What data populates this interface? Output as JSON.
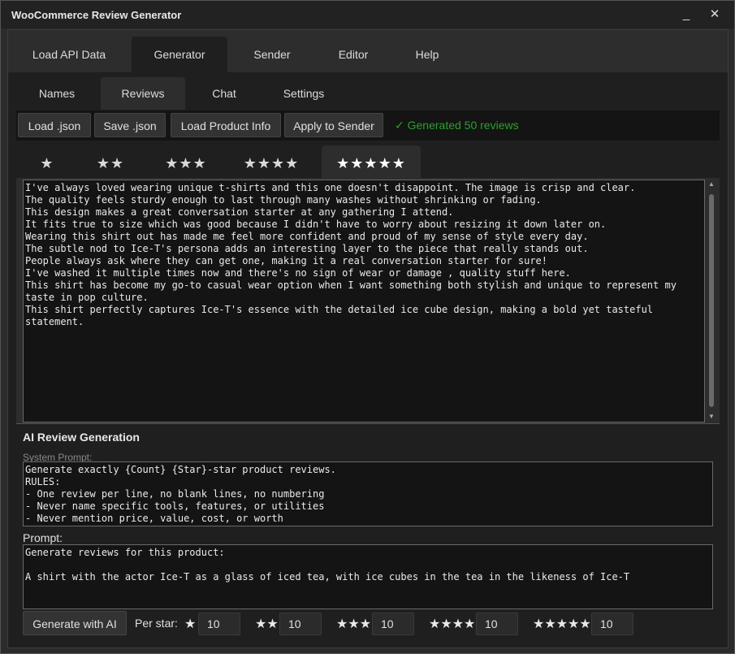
{
  "window": {
    "title": "WooCommerce Review Generator",
    "minimize": "_",
    "close": "✕"
  },
  "main_tabs": [
    {
      "label": "Load API Data"
    },
    {
      "label": "Generator",
      "active": true
    },
    {
      "label": "Sender"
    },
    {
      "label": "Editor"
    },
    {
      "label": "Help"
    }
  ],
  "sub_tabs": [
    {
      "label": "Names"
    },
    {
      "label": "Reviews",
      "active": true
    },
    {
      "label": "Chat"
    },
    {
      "label": "Settings"
    }
  ],
  "toolbar": {
    "load_json": "Load .json",
    "save_json": "Save .json",
    "load_product_info": "Load Product Info",
    "apply_to_sender": "Apply to Sender",
    "status": "✓ Generated 50 reviews",
    "status_color": "#2aa12a"
  },
  "star_tabs": [
    {
      "label": "★"
    },
    {
      "label": "★★"
    },
    {
      "label": "★★★"
    },
    {
      "label": "★★★★"
    },
    {
      "label": "★★★★★",
      "active": true
    }
  ],
  "reviews": [
    "I've always loved wearing unique t-shirts and this one doesn't disappoint. The image is crisp and clear.",
    "The quality feels sturdy enough to last through many washes without shrinking or fading.",
    "This design makes a great conversation starter at any gathering I attend.",
    "It fits true to size which was good because I didn't have to worry about resizing it down later on.",
    "Wearing this shirt out has made me feel more confident and proud of my sense of style every day.",
    "The subtle nod to Ice-T's persona adds an interesting layer to the piece that really stands out.",
    "People always ask where they can get one, making it a real conversation starter for sure!",
    "I've washed it multiple times now and there's no sign of wear or damage , quality stuff here.",
    "This shirt has become my go-to casual wear option when I want something both stylish and unique to represent my taste in pop culture.",
    "This shirt perfectly captures Ice-T's essence with the detailed ice cube design, making a bold yet tasteful statement."
  ],
  "ai": {
    "title": "AI Review Generation",
    "system_prompt_label": "System Prompt:",
    "system_prompt_lines": [
      "Generate exactly {Count} {Star}-star product reviews.",
      "RULES:",
      "- One review per line, no blank lines, no numbering",
      "- Never name specific tools, features, or utilities",
      "- Never mention price, value, cost, or worth"
    ],
    "prompt_label": "Prompt:",
    "prompt_lines": [
      "Generate reviews for this product:",
      " ",
      "A shirt with the actor Ice-T as a glass of iced tea, with ice cubes in the tea in the likeness of Ice-T"
    ],
    "generate_button": "Generate with AI",
    "per_star_label": "Per star:",
    "per_star": [
      {
        "stars": "★",
        "value": "10"
      },
      {
        "stars": "★★",
        "value": "10"
      },
      {
        "stars": "★★★",
        "value": "10"
      },
      {
        "stars": "★★★★",
        "value": "10"
      },
      {
        "stars": "★★★★★",
        "value": "10"
      }
    ]
  }
}
